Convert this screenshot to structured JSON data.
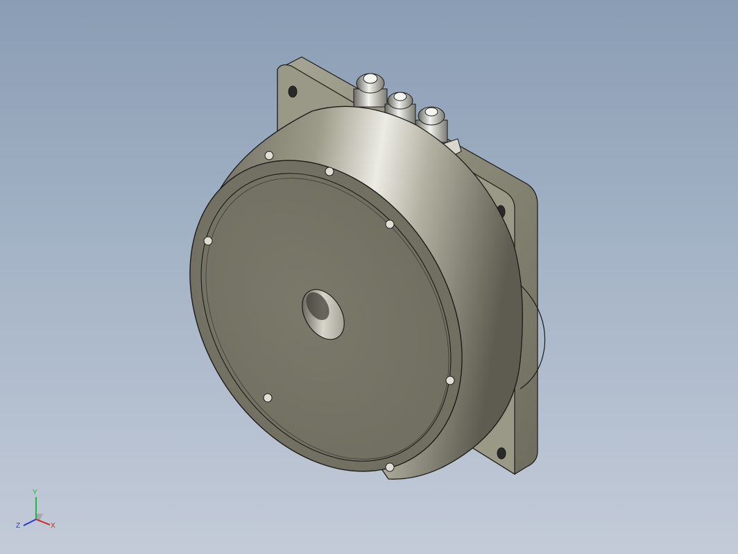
{
  "viewport": {
    "background_top": "#8a9db4",
    "background_bottom": "#c3cbd8"
  },
  "model": {
    "description_color": "#8e8b78",
    "body_color": "#8f8c7a",
    "face_color": "#757363",
    "edge_color": "#1a1a18"
  },
  "triad": {
    "x_label": "X",
    "y_label": "Y",
    "z_label": "Z",
    "x_color": "#d42020",
    "y_color": "#1fb83a",
    "z_color": "#2438d8"
  }
}
